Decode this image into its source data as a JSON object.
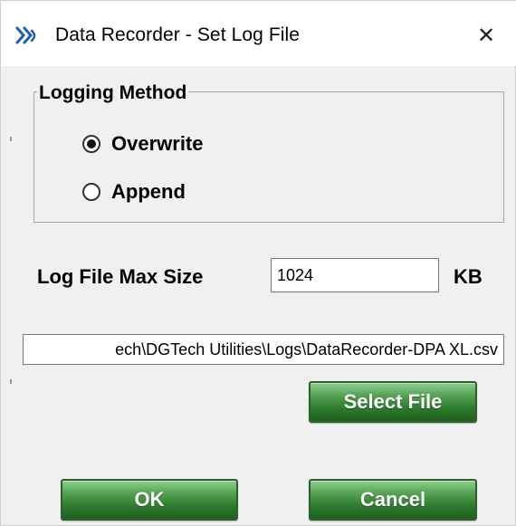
{
  "window": {
    "title": "Data Recorder - Set Log File",
    "app_icon": "dg-logo-icon",
    "close_icon": "close-icon",
    "close_glyph": "✕"
  },
  "logging_method": {
    "group_label": "Logging Method",
    "options": [
      {
        "label": "Overwrite",
        "selected": true
      },
      {
        "label": "Append",
        "selected": false
      }
    ]
  },
  "max_size": {
    "label": "Log File Max Size",
    "value": "1024",
    "unit": "KB"
  },
  "log_file": {
    "path_visible": "ech\\DGTech Utilities\\Logs\\DataRecorder-DPA XL.csv"
  },
  "buttons": {
    "select_file": "Select File",
    "ok": "OK",
    "cancel": "Cancel"
  },
  "colors": {
    "button_green": "#2d7d2d",
    "window_bg": "#f0f0f0",
    "titlebar_bg": "#ffffff",
    "icon_blue": "#1f5fa8"
  }
}
